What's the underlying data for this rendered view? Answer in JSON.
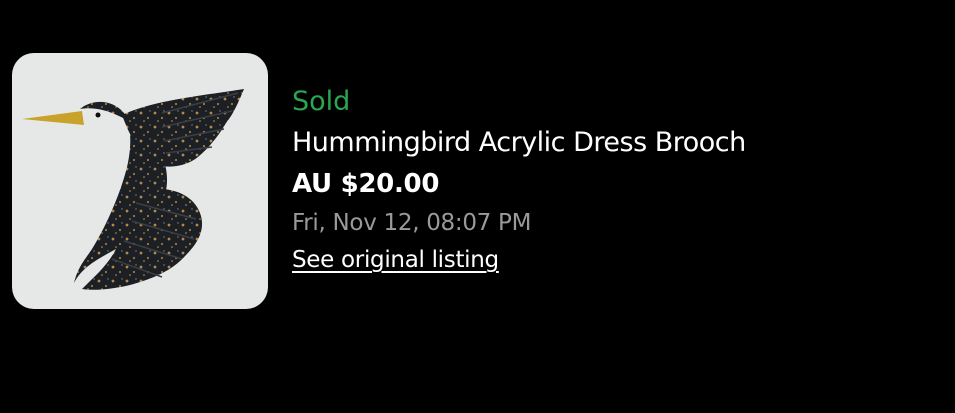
{
  "item": {
    "image_alt": "hummingbird-brooch-photo",
    "status": "Sold",
    "title": "Hummingbird Acrylic Dress Brooch",
    "price": "AU $20.00",
    "date": "Fri, Nov 12, 08:07 PM",
    "link_label": "See original listing"
  },
  "colors": {
    "background": "#000000",
    "status_green": "#2aa650",
    "date_grey": "#9a9a9a",
    "image_bg": "#e6e8e8"
  }
}
